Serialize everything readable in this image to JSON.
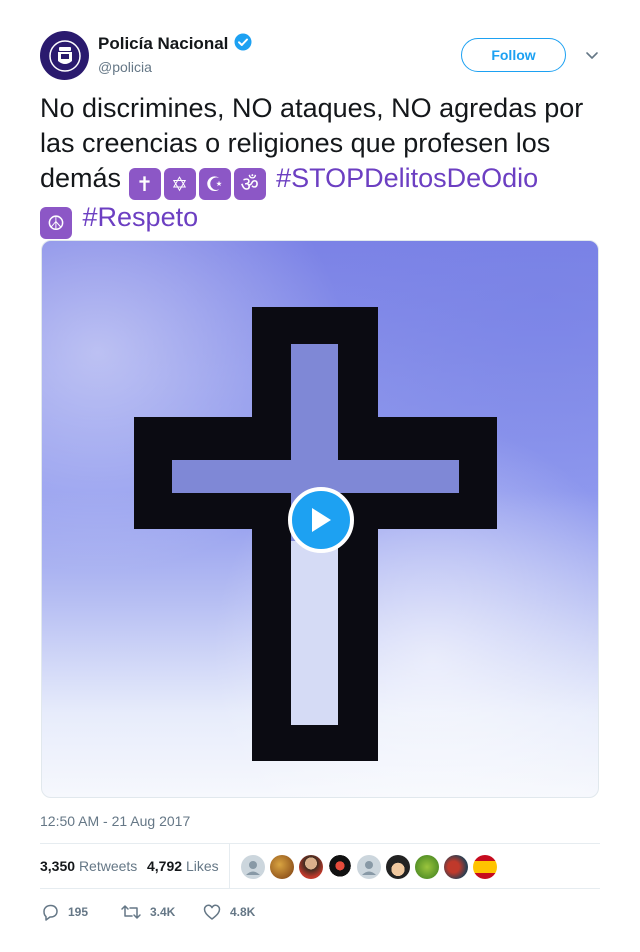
{
  "account": {
    "name": "Policía Nacional",
    "handle": "@policia",
    "verified": true,
    "brand_color": "#2a1a6e"
  },
  "follow_label": "Follow",
  "tweet": {
    "text_main": "No discrimines, NO ataques, NO agredas por las creencias o religiones que profesen los demás",
    "emoji": [
      "✝️",
      "✡️",
      "☪️",
      "🕉️",
      "☮️"
    ],
    "hashtag_1": "#STOPDelitosDeOdio",
    "hashtag_2": "#Respeto",
    "hashtag_color": "#6c3fc2"
  },
  "media": {
    "type": "video",
    "subject": "black cross on sky background",
    "play_icon": "play-icon"
  },
  "timestamp": "12:50 AM - 21 Aug 2017",
  "stats": {
    "retweets_count": "3,350",
    "retweets_label": "Retweets",
    "likes_count": "4,792",
    "likes_label": "Likes",
    "liker_avatar_count": 9
  },
  "actions": {
    "reply_count": "195",
    "retweet_count": "3.4K",
    "like_count": "4.8K"
  },
  "colors": {
    "link_blue": "#1da1f2",
    "text_secondary": "#657786",
    "divider": "#e6ecf0"
  }
}
